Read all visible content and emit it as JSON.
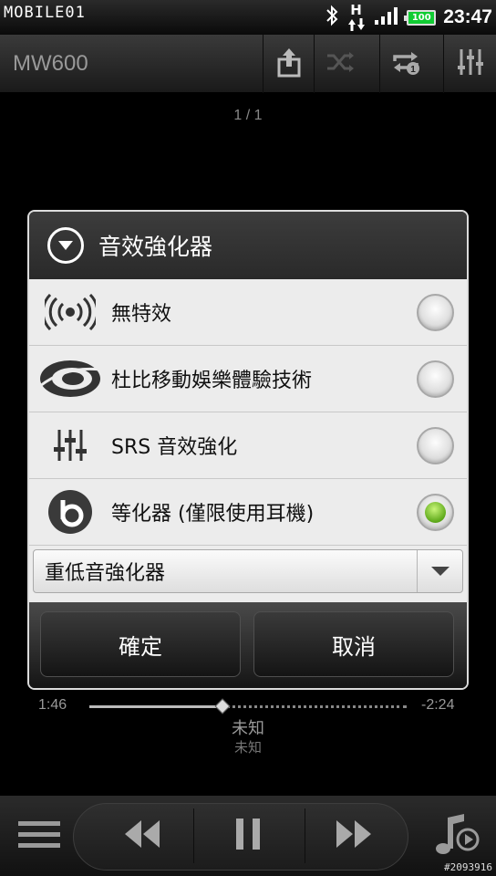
{
  "status_bar": {
    "brand_watermark": "MOBILE01",
    "network_type": "H",
    "battery_level": "100",
    "time": "23:47",
    "icons": [
      "bluetooth-icon",
      "data-arrows-icon",
      "signal-icon",
      "battery-icon"
    ]
  },
  "app_bar": {
    "title": "MW600",
    "actions": [
      "share-icon",
      "shuffle-icon",
      "repeat-one-icon",
      "equalizer-icon"
    ]
  },
  "playlist": {
    "position": "1 / 1"
  },
  "dialog": {
    "title": "音效強化器",
    "options": [
      {
        "label": "無特效",
        "icon": "surround-waves-icon",
        "selected": false
      },
      {
        "label": "杜比移動娛樂體驗技術",
        "icon": "dolby-icon",
        "selected": false
      },
      {
        "label": "SRS 音效強化",
        "icon": "sliders-icon",
        "selected": false
      },
      {
        "label": "等化器 (僅限使用耳機)",
        "icon": "beats-icon",
        "selected": true
      }
    ],
    "preset": {
      "value": "重低音強化器"
    },
    "buttons": {
      "ok": "確定",
      "cancel": "取消"
    }
  },
  "player": {
    "elapsed": "1:46",
    "remaining": "-2:24",
    "progress_fraction": 0.42,
    "artist": "未知",
    "album": "未知"
  },
  "controls": [
    "menu-icon",
    "previous-icon",
    "pause-icon",
    "next-icon",
    "library-icon"
  ],
  "image_number": "#2093916",
  "colors": {
    "radio_selected": "#5ea91a",
    "dialog_border": "#dcdcdc"
  }
}
